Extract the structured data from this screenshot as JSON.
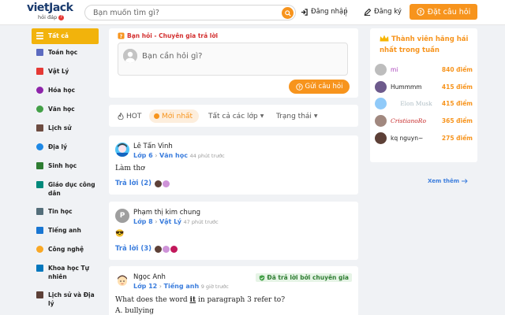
{
  "header": {
    "logo_main": "vietJack",
    "logo_sub": "hỏi đáp",
    "logo_badge": "?",
    "search_placeholder": "Bạn muốn tìm gì?",
    "login_label": "Đăng nhập",
    "signup_label": "Đăng ký",
    "ask_label": "Đặt câu hỏi"
  },
  "sidebar": {
    "items": [
      {
        "label": "Tất cả",
        "icon": "grid-icon",
        "color": "#ffffff"
      },
      {
        "label": "Toán học",
        "icon": "math-book-icon",
        "color": "#5c6bc0"
      },
      {
        "label": "Vật Lý",
        "icon": "physics-icon",
        "color": "#e53935"
      },
      {
        "label": "Hóa học",
        "icon": "flask-icon",
        "color": "#8e24aa"
      },
      {
        "label": "Văn học",
        "icon": "pen-icon",
        "color": "#43a047"
      },
      {
        "label": "Lịch sử",
        "icon": "history-icon",
        "color": "#6d4c41"
      },
      {
        "label": "Địa lý",
        "icon": "globe-icon",
        "color": "#1e88e5"
      },
      {
        "label": "Sinh học",
        "icon": "leaf-icon",
        "color": "#2e7d32"
      },
      {
        "label": "Giáo dục công dân",
        "icon": "civics-icon",
        "color": "#00897b"
      },
      {
        "label": "Tin học",
        "icon": "computer-icon",
        "color": "#546e7a"
      },
      {
        "label": "Tiếng anh",
        "icon": "english-icon",
        "color": "#1976d2"
      },
      {
        "label": "Công nghệ",
        "icon": "tech-icon",
        "color": "#f9a825"
      },
      {
        "label": "Khoa học Tự nhiên",
        "icon": "science-icon",
        "color": "#0277bd"
      },
      {
        "label": "Lịch sử và Địa lý",
        "icon": "history-geo-icon",
        "color": "#5d4037"
      }
    ]
  },
  "ask": {
    "heading": "Bạn hỏi - Chuyên gia trả lời",
    "placeholder": "Bạn cần hỏi gì?",
    "button": "Gửi câu hỏi"
  },
  "tabs": {
    "hot": "HOT",
    "newest": "Mới nhất",
    "classes": "Tất cả các lớp",
    "status": "Trạng thái"
  },
  "posts": [
    {
      "name": "Lê Tấn Vinh",
      "grade": "Lớp 6",
      "subject": "Văn học",
      "time": "44 phút trước",
      "body": "Làm thơ",
      "answers": "Trả lời (2)"
    },
    {
      "name": "Phạm thị kim chung",
      "avatar_letter": "P",
      "grade": "Lớp 8",
      "subject": "Vật Lý",
      "time": "47 phút trước",
      "body": "😎",
      "answers": "Trả lời (3)"
    },
    {
      "name": "Ngọc Anh",
      "grade": "Lớp 12",
      "subject": "Tiếng anh",
      "time": "9 giờ trước",
      "badge": "Đã trả lời bởi chuyên gia",
      "body_prefix": "What does the word ",
      "body_em": "it",
      "body_suffix": " in paragraph 3 refer to?",
      "body_line2": "A. bullying"
    }
  ],
  "ranking": {
    "title": "Thành viên hăng hái nhất trong tuần",
    "members": [
      {
        "name": "mi",
        "points": "840 điểm",
        "color": "#bdbdbd",
        "style": "plain"
      },
      {
        "name": "Hummmm",
        "points": "415 điểm",
        "color": "#6d5a8c",
        "style": "plain"
      },
      {
        "name": "Elon Musk",
        "points": "415 điểm",
        "color": "#90caf9",
        "style": "faded"
      },
      {
        "name": "CristianoRo",
        "points": "365 điểm",
        "color": "#a1887f",
        "style": "red-script"
      },
      {
        "name": "kq nguyn~",
        "points": "275 điểm",
        "color": "#5d4037",
        "style": "plain"
      }
    ],
    "see_more": "Xem thêm"
  }
}
